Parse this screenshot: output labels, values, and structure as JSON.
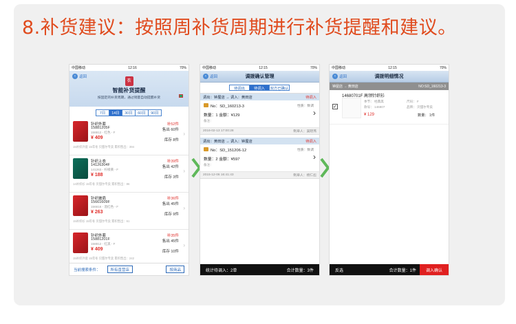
{
  "heading": "8.补货建议：按照周补货周期进行补货提醒和建议。",
  "status": {
    "carrier": "中国移动",
    "time": "12:16",
    "battery": "70%",
    "carrier2": "中国移动",
    "time2": "12:15",
    "battery2": "70%"
  },
  "phone1": {
    "back": "返回",
    "logo": "衣",
    "title": "智能补货提醒",
    "subtitle": "按固定的补货周期，通过销量自动提醒补货",
    "tabs": [
      "7日",
      "14日",
      "30日",
      "60日",
      "90日"
    ],
    "items": [
      {
        "name": "针织外套",
        "code": "15881205F",
        "meta": "158812 - 红色 - F",
        "price": "¥ 409",
        "rep": "补52件",
        "sold": "售出 60件",
        "stock": "库存 8件",
        "foot": "15补织外套  15年冬  贝甜尔专卖  累积售出：394"
      },
      {
        "name": "针织上衣",
        "code": "14126304F",
        "meta": "141263 - 柠檬黄 - F",
        "price": "¥ 188",
        "rep": "补39件",
        "sold": "售出 42件",
        "stock": "库存 3件",
        "foot": "14补织衫  15年冬  贝甜尔专卖  累积售出：86"
      },
      {
        "name": "针织披肩",
        "code": "15661609F",
        "meta": "156616 - 酒红色 - F",
        "price": "¥ 263",
        "rep": "补36件",
        "sold": "售出 45件",
        "stock": "库存 9件",
        "foot": "15补织衫  15年冬  贝甜尔专卖  累积售出：61"
      },
      {
        "name": "针织外套",
        "code": "15881201F",
        "meta": "158812 - 红黑 - F",
        "price": "¥ 409",
        "rep": "补35件",
        "sold": "售出 45件",
        "stock": "库存 10件",
        "foot": "15补织外套  15年冬  贝甜尔专卖  累积售出：242"
      }
    ],
    "bottom_label": "当前搜索条件：",
    "bottom_btn1": "所有直营店",
    "bottom_btn2": "按商品"
  },
  "phone2": {
    "back": "返回",
    "title": "调拨确认管理",
    "tabs": [
      "待调出",
      "待调入",
      "双方已确认"
    ],
    "transfers": [
      {
        "route": "调出：钟屋店 → 调入：黄田店",
        "status": "待调入",
        "no": "No：SD_160213-3",
        "nature": "性质：数调",
        "qty": "数量：1  金额：¥129",
        "remark": "备注：",
        "date": "2016-02-13 17:00:28",
        "maker": "制单人：吴晓燕"
      },
      {
        "route": "调出：黄田店 → 调入：钟屋店",
        "status": "待调入",
        "no": "No：SD_151206-12",
        "nature": "性质：数调",
        "qty": "数量：2  金额：¥597",
        "remark": "备注：",
        "date": "2015-12-06 16:41:43",
        "maker": "制单人：杨仁彪"
      }
    ],
    "bottom_left": "统计待调入：2单",
    "bottom_right": "合计数量：3件"
  },
  "phone3": {
    "back": "返回",
    "title": "调拨明细情况",
    "route_left": "钟屋店 → 黄田店",
    "route_right": "NO:SD_160213-3",
    "detail": {
      "title": "14680701F  高领针织衫",
      "check": "✓",
      "l1": "季节：  经典黑",
      "l2": "款号：  146807",
      "r1": "尺码：  F",
      "r2": "品牌：  贝甜尔专卖",
      "price": "¥ 129",
      "cnt": "数量：  1件"
    },
    "bottom_left": "反选",
    "bottom_total": "合计数量：1件",
    "bottom_confirm": "调入确认"
  },
  "colors": {
    "accent": "#e04b1e",
    "blue": "#2e6fcc",
    "arrow": "#5fb85a"
  }
}
